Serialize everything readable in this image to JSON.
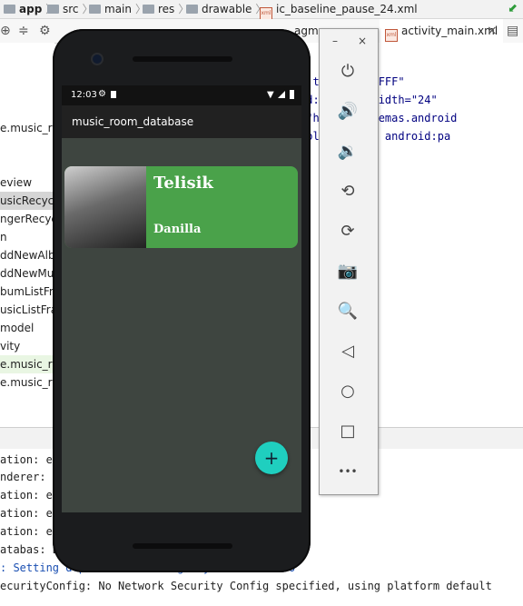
{
  "ide": {
    "breadcrumb": [
      "app",
      "src",
      "main",
      "res",
      "drawable",
      "ic_baseline_pause_24.xml"
    ],
    "tabs": [
      {
        "label": "agm"
      },
      {
        "label": "activity_main.xml"
      }
    ],
    "project_tree": [
      "e.music_ro",
      "eview",
      "usicRecycle",
      "ngerRecycle",
      "n",
      "ddNewAlbu",
      "ddNewMus",
      "bumListFra",
      "usicListFrag",
      "model",
      "vity",
      "e.music_ro",
      "e.music_ro"
    ],
    "code_lines": [
      "p:tint=\"#FFFFFF\"",
      "id:viewportWidth=\"24\"",
      "=\"http://schemas.android",
      "color/white\" android:pa"
    ],
    "logcat": [
      {
        "text": "ation: eg                                          0xed0dae80)",
        "color": "normal"
      },
      {
        "text": "nderer: e                             le         with handle 0xd4113ce0",
        "color": "normal"
      },
      {
        "text": "ation: eg                                          0xed0dae80)",
        "color": "normal"
      },
      {
        "text": "ation: eg                                          0xed0dae80)",
        "color": "normal"
      },
      {
        "text": "ation: eg                                          0xed0dae80)",
        "color": "normal"
      },
      {
        "text": "atabas: B                                        457(5MB) AllocSpace objects, 7(136",
        "color": "normal"
      },
      {
        "text": ": Setting                                        d.provider.Settings.System to andro",
        "color": "blue"
      },
      {
        "text": "ecurityConfig: No Network Security Config specified, using platform default",
        "color": "normal"
      }
    ]
  },
  "phone": {
    "status_time": "12:03",
    "app_title": "music_room_database",
    "card": {
      "song": "Telisik",
      "artist": "Danilla",
      "color": "#4aa24a"
    },
    "fab_label": "+"
  },
  "emulator": {
    "minimize": "–",
    "close": "×",
    "buttons": [
      {
        "name": "power-icon",
        "glyph": "⏻"
      },
      {
        "name": "volume-up-icon",
        "glyph": "🔊"
      },
      {
        "name": "volume-down-icon",
        "glyph": "🔉"
      },
      {
        "name": "rotate-left-icon",
        "glyph": "⟲"
      },
      {
        "name": "rotate-right-icon",
        "glyph": "⟳"
      },
      {
        "name": "camera-icon",
        "glyph": "📷"
      },
      {
        "name": "zoom-icon",
        "glyph": "🔍"
      },
      {
        "name": "back-icon",
        "glyph": "◁"
      },
      {
        "name": "home-icon",
        "glyph": "○"
      },
      {
        "name": "overview-icon",
        "glyph": "□"
      },
      {
        "name": "more-icon",
        "glyph": "•••"
      }
    ]
  }
}
